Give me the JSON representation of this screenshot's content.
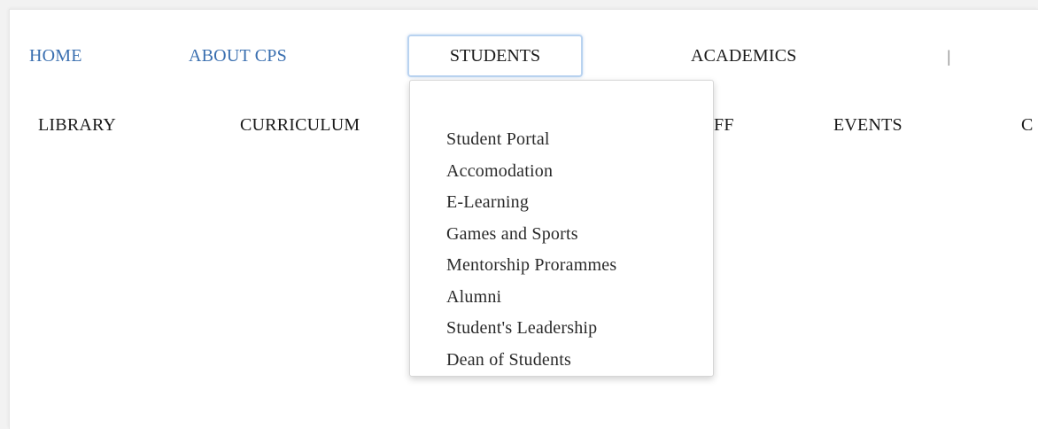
{
  "nav": {
    "primary": [
      {
        "id": "home",
        "label": "HOME"
      },
      {
        "id": "about",
        "label": "ABOUT CPS"
      },
      {
        "id": "students",
        "label": "STUDENTS"
      },
      {
        "id": "academics",
        "label": "ACADEMICS"
      }
    ],
    "separator": "|",
    "secondary": [
      {
        "id": "library",
        "label": "LIBRARY"
      },
      {
        "id": "curriculum",
        "label": "CURRICULUM"
      },
      {
        "id": "staff_partial",
        "label": "FF"
      },
      {
        "id": "events",
        "label": "EVENTS"
      },
      {
        "id": "cut_off",
        "label": "C"
      }
    ]
  },
  "students_dropdown": {
    "items": [
      "Student Portal",
      "Accomodation",
      "E-Learning",
      "Games and Sports",
      "Mentorship Prorammes",
      "Alumni",
      "Student's Leadership",
      "Dean of Students"
    ]
  },
  "colors": {
    "link_blue": "#3a6fb0",
    "text_dark": "#1a1a1a",
    "focus_border": "#b9d3f0"
  }
}
